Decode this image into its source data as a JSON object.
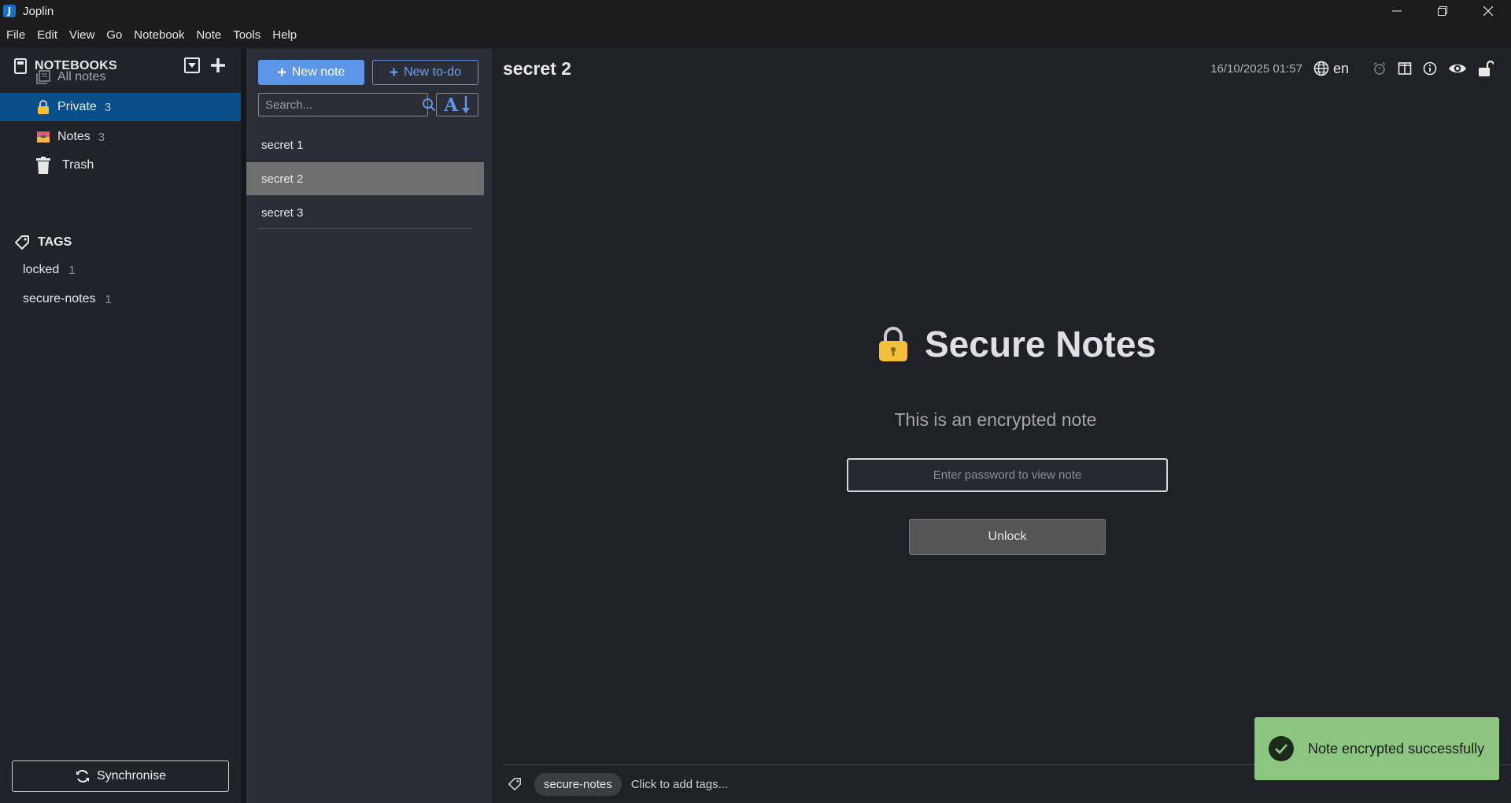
{
  "window": {
    "title": "Joplin",
    "logo_letter": "J"
  },
  "menu": [
    "File",
    "Edit",
    "View",
    "Go",
    "Notebook",
    "Note",
    "Tools",
    "Help"
  ],
  "sidebar": {
    "notebooks_title": "NOTEBOOKS",
    "items": [
      {
        "label": "All notes",
        "count": "",
        "icon": "all-notes-icon"
      },
      {
        "label": "Private",
        "count": "3",
        "icon": "lock-icon",
        "selected": true
      },
      {
        "label": "Notes",
        "count": "3",
        "icon": "inbox-icon"
      },
      {
        "label": "Trash",
        "count": "",
        "icon": "trash-icon"
      }
    ],
    "tags_title": "TAGS",
    "tags": [
      {
        "label": "locked",
        "count": "1"
      },
      {
        "label": "secure-notes",
        "count": "1"
      }
    ],
    "sync_label": "Synchronise"
  },
  "notelist": {
    "new_note": "New note",
    "new_todo": "New to-do",
    "search_placeholder": "Search...",
    "sort_letter": "A",
    "notes": [
      {
        "title": "secret 1"
      },
      {
        "title": "secret 2",
        "selected": true
      },
      {
        "title": "secret 3"
      }
    ]
  },
  "editor": {
    "title": "secret 2",
    "date": "16/10/2025 01:57",
    "lang": "en",
    "heading": "Secure Notes",
    "subtitle": "This is an encrypted note",
    "password_placeholder": "Enter password to view note",
    "unlock_label": "Unlock",
    "tag": "secure-notes",
    "add_tags": "Click to add tags..."
  },
  "toast": {
    "message": "Note encrypted successfully",
    "color": "#8cc681"
  },
  "colors": {
    "accent": "#5d95e8",
    "selected_notebook": "#0b4f8a",
    "lock": "#f4c03a"
  }
}
